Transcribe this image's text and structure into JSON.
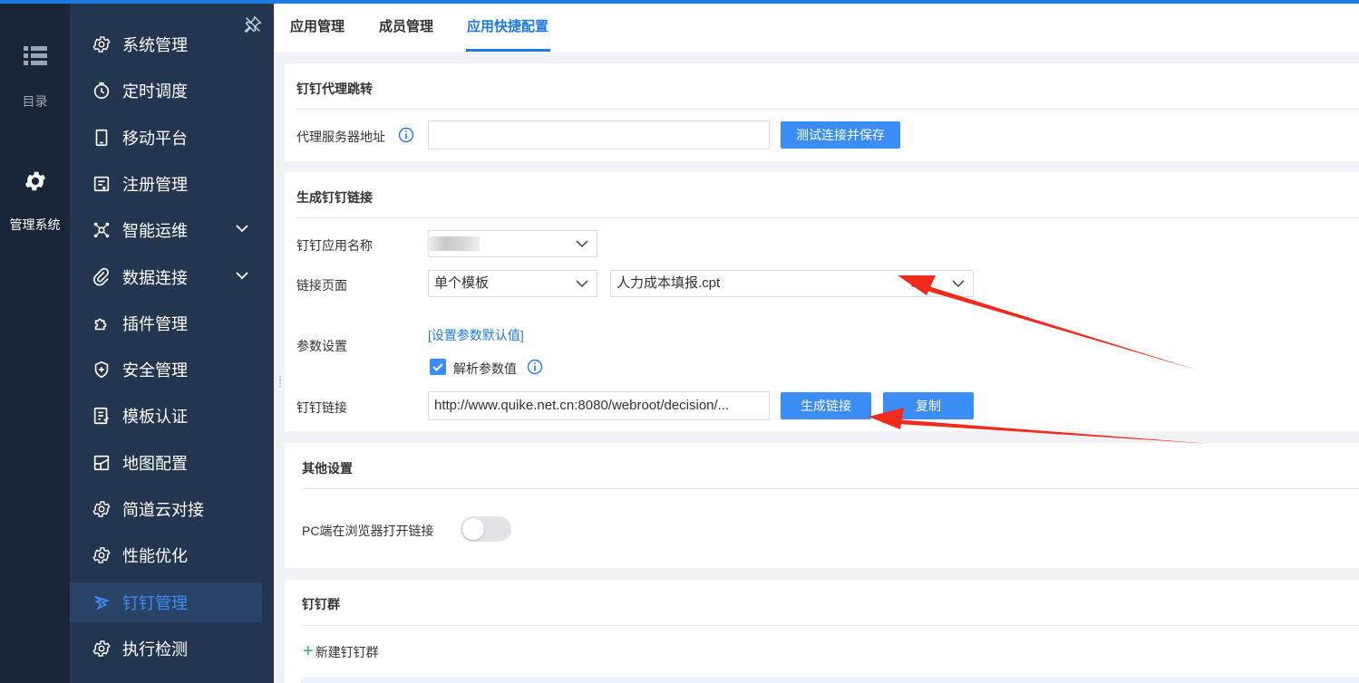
{
  "rail": {
    "catalog_label": "目录",
    "system_label": "管理系统"
  },
  "sidebar": {
    "items": [
      {
        "label": "系统管理",
        "icon": "gear-icon"
      },
      {
        "label": "定时调度",
        "icon": "timer-icon"
      },
      {
        "label": "移动平台",
        "icon": "mobile-icon"
      },
      {
        "label": "注册管理",
        "icon": "register-icon"
      },
      {
        "label": "智能运维",
        "icon": "ops-icon",
        "expandable": true
      },
      {
        "label": "数据连接",
        "icon": "link-icon",
        "expandable": true
      },
      {
        "label": "插件管理",
        "icon": "puzzle-icon"
      },
      {
        "label": "安全管理",
        "icon": "shield-icon"
      },
      {
        "label": "模板认证",
        "icon": "template-icon"
      },
      {
        "label": "地图配置",
        "icon": "map-icon"
      },
      {
        "label": "简道云对接",
        "icon": "gear-icon"
      },
      {
        "label": "性能优化",
        "icon": "gear-icon"
      },
      {
        "label": "钉钉管理",
        "icon": "dingtalk-icon",
        "active": true
      },
      {
        "label": "执行检测",
        "icon": "gear-icon"
      }
    ]
  },
  "tabs": [
    {
      "label": "应用管理"
    },
    {
      "label": "成员管理"
    },
    {
      "label": "应用快捷配置",
      "active": true
    }
  ],
  "proxy": {
    "title": "钉钉代理跳转",
    "server_label": "代理服务器地址",
    "server_value": "",
    "test_button": "测试连接并保存"
  },
  "generate": {
    "title": "生成钉钉链接",
    "app_name_label": "钉钉应用名称",
    "link_page_label": "链接页面",
    "link_page_mode": "单个模板",
    "template_value": "人力成本填报.cpt",
    "param_label": "参数设置",
    "param_default_link": "[设置参数默认值]",
    "parse_param_label": "解析参数值",
    "parse_param_checked": true,
    "dingtalk_link_label": "钉钉链接",
    "dingtalk_link_value": "http://www.quike.net.cn:8080/webroot/decision/...",
    "generate_button": "生成链接",
    "copy_button": "复制"
  },
  "other": {
    "title": "其他设置",
    "pc_browser_label": "PC端在浏览器打开链接",
    "pc_browser_enabled": false
  },
  "group": {
    "title": "钉钉群",
    "new_group_label": "新建钉钉群"
  },
  "colors": {
    "accent": "#1f7ae0",
    "button": "#3b8df5",
    "sidebar": "#243550",
    "rail": "#1a2638",
    "annotation_arrow": "#f02b1d"
  }
}
